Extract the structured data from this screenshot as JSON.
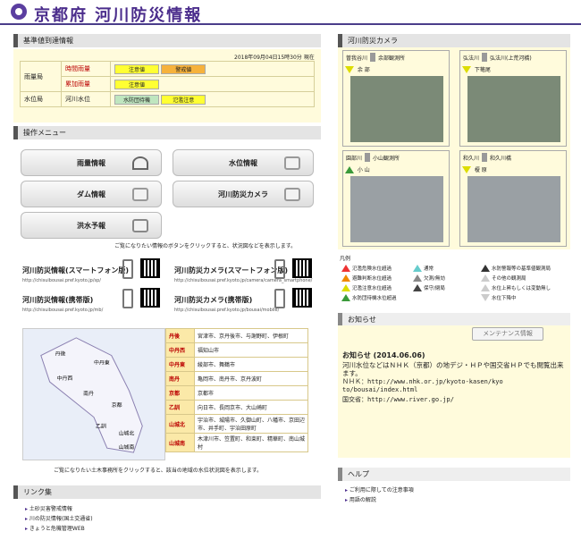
{
  "header": {
    "title": "京都府 河川防災情報"
  },
  "obs": {
    "section": "基準値到達情報",
    "timestamp": "2018年09月04日15時30分 現在",
    "rows": [
      {
        "station": "雨量局",
        "item": "時間雨量",
        "tags": [
          "注意値",
          "警戒値"
        ]
      },
      {
        "station": "",
        "item": "累加雨量",
        "tags": [
          "注意値"
        ]
      },
      {
        "station": "水位局",
        "item": "河川水位",
        "tags": [
          "水防団待機",
          "氾濫注意"
        ]
      }
    ]
  },
  "menu": {
    "section": "操作メニュー",
    "buttons": [
      "雨量情報",
      "水位情報",
      "ダム情報",
      "河川防災カメラ",
      "洪水予報"
    ],
    "note": "ご覧になりたい情報のボタンをクリックすると、状況図などを表示します。"
  },
  "mobile": [
    {
      "title": "河川防災情報(スマートフォン版)",
      "url": "http://chisuibousai.pref.kyoto.jp/sp/"
    },
    {
      "title": "河川防災カメラ(スマートフォン版)",
      "url": "http://chisuibousai.pref.kyoto.jp/camera/camera_smartphone/"
    },
    {
      "title": "河川防災情報(携帯版)",
      "url": "http://chisuibousai.pref.kyoto.jp/mb/"
    },
    {
      "title": "河川防災カメラ(携帯版)",
      "url": "http://chisuibousai.pref.kyoto.jp/bousai/mobile/"
    }
  ],
  "offices": [
    {
      "k": "丹後",
      "v": "宮津市、京丹後市、与謝野町、伊根町"
    },
    {
      "k": "中丹西",
      "v": "福知山市"
    },
    {
      "k": "中丹東",
      "v": "綾部市、舞鶴市"
    },
    {
      "k": "南丹",
      "v": "亀岡市、南丹市、京丹波町"
    },
    {
      "k": "京都",
      "v": "京都市"
    },
    {
      "k": "乙訓",
      "v": "向日市、長岡京市、大山崎町"
    },
    {
      "k": "山城北",
      "v": "宇治市、城陽市、久御山町、八幡市、京田辺市、井手町、宇治田原町"
    },
    {
      "k": "山城南",
      "v": "木津川市、笠置町、和束町、精華町、南山城村"
    }
  ],
  "map_labels": [
    "丹後",
    "中丹西",
    "中丹東",
    "南丹",
    "京都",
    "乙訓",
    "山城北",
    "山城南"
  ],
  "office_note": "ご覧になりたい土木事務所をクリックすると、該当の地域の水位状況図を表示します。",
  "links": {
    "section": "リンク集",
    "items": [
      "土砂災害警戒情報",
      "川の防災情報(国土交通省)",
      "きょうと危機管理WEB"
    ]
  },
  "camera": {
    "section": "河川防災カメラ",
    "cams": [
      {
        "a": "曽我谷川",
        "b": "余部観測所",
        "c": "余 部"
      },
      {
        "a": "弘法川",
        "b": "弘法川(上荒河橋)",
        "c": "下篭尾"
      },
      {
        "a": "園部川",
        "b": "小山観測所",
        "c": "小 山"
      },
      {
        "a": "和久川",
        "b": "和久川橋",
        "c": "榎 原"
      }
    ]
  },
  "legend": {
    "title": "凡例",
    "items": [
      "氾濫危険水位超過",
      "避難判断水位超過",
      "氾濫注意水位超過",
      "水防団待機水位超過",
      "通常",
      "欠測/無効",
      "保守/閉局",
      "水防警報等の基準値観測局",
      "その他の観測局",
      "水位上昇もしくは変動無し",
      "水位下降中"
    ]
  },
  "news": {
    "section": "お知らせ",
    "button": "メンテナンス情報",
    "heading": "お知らせ (2014.06.06)",
    "body": "河川水位などはＮＨＫ（京都）の地デジ・ＨＰや国交省ＨＰでも閲覧出来ます。",
    "l1": "ＮＨＫ：http://www.nhk.or.jp/kyoto-kasen/kyoto/bousai/index.html",
    "l2": "国交省：http://www.river.go.jp/"
  },
  "help": {
    "section": "ヘルプ",
    "items": [
      "ご利用に際しての注意事項",
      "用語の解説"
    ]
  }
}
